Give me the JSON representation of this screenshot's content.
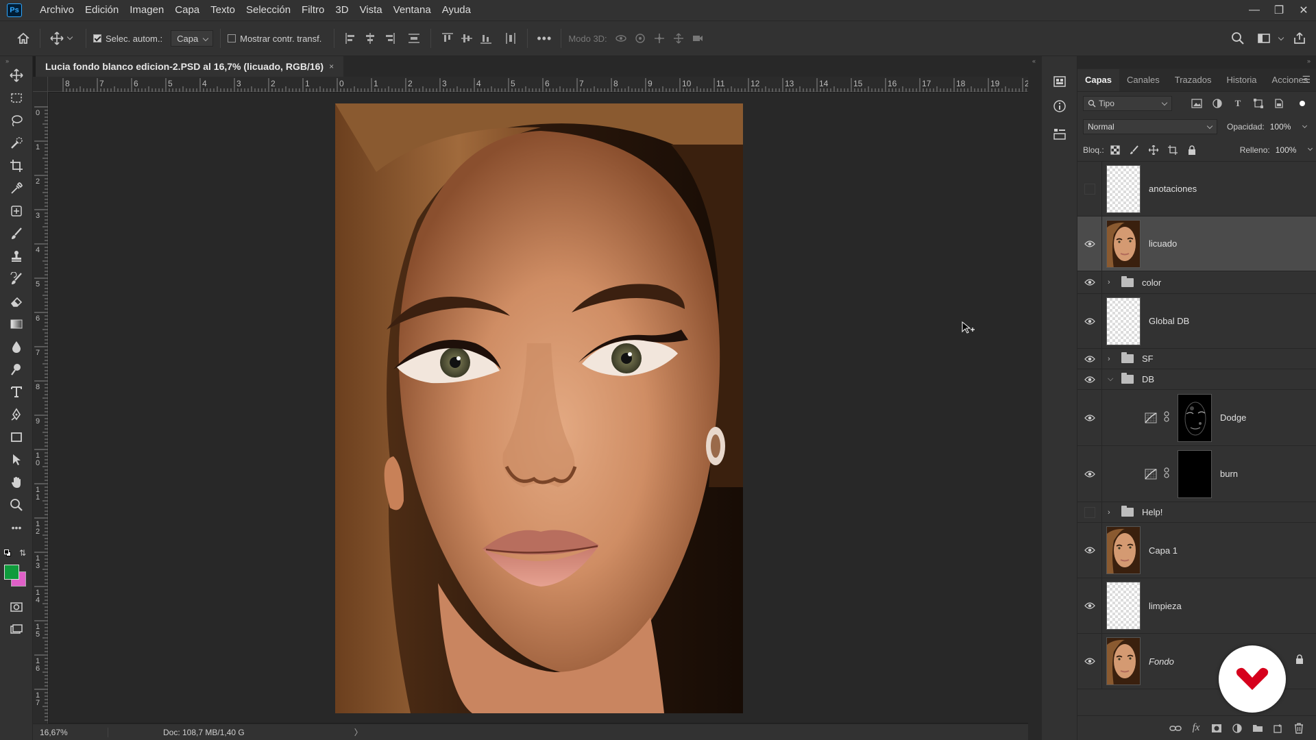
{
  "app": {
    "logo_text": "Ps"
  },
  "menu": [
    "Archivo",
    "Edición",
    "Imagen",
    "Capa",
    "Texto",
    "Selección",
    "Filtro",
    "3D",
    "Vista",
    "Ventana",
    "Ayuda"
  ],
  "options": {
    "auto_select_label": "Selec. autom.:",
    "auto_select_target": "Capa",
    "show_transform_label": "Mostrar contr. transf.",
    "mode_3d_label": "Modo 3D:"
  },
  "document": {
    "tab_title": "Lucia fondo blanco edicion-2.PSD al 16,7% (licuado, RGB/16)",
    "tab_close": "×"
  },
  "ruler": {
    "h_labels": [
      "8",
      "7",
      "6",
      "5",
      "4",
      "3",
      "2",
      "1",
      "0",
      "1",
      "2",
      "3",
      "4",
      "5",
      "6",
      "7",
      "8",
      "9",
      "10",
      "11",
      "12",
      "13",
      "14",
      "15",
      "16",
      "17",
      "18",
      "19",
      "2"
    ],
    "v_labels": [
      "0",
      "1",
      "2",
      "3",
      "4",
      "5",
      "6",
      "7",
      "8",
      "9",
      "10",
      "11",
      "12",
      "13",
      "14",
      "15",
      "16",
      "17"
    ]
  },
  "status": {
    "zoom": "16,67%",
    "doc": "Doc: 108,7 MB/1,40 G",
    "arrow": "〉"
  },
  "panel": {
    "tabs": [
      "Capas",
      "Canales",
      "Trazados",
      "Historia",
      "Acciones"
    ],
    "active_tab": "Capas",
    "filter_type": "Tipo",
    "blend_mode": "Normal",
    "opacity_label": "Opacidad:",
    "opacity_value": "100%",
    "lock_label": "Bloq.:",
    "fill_label": "Relleno:",
    "fill_value": "100%"
  },
  "layers": [
    {
      "name": "anotaciones",
      "kind": "layer",
      "visible": false,
      "thumb": "trans",
      "height": 80
    },
    {
      "name": "licuado",
      "kind": "layer",
      "visible": true,
      "thumb": "face",
      "height": 80,
      "selected": true
    },
    {
      "name": "color",
      "kind": "group",
      "visible": true,
      "expanded": false,
      "height": 33
    },
    {
      "name": "Global DB",
      "kind": "layer",
      "visible": true,
      "thumb": "trans",
      "height": 80
    },
    {
      "name": "SF",
      "kind": "group",
      "visible": true,
      "expanded": false,
      "height": 30
    },
    {
      "name": "DB",
      "kind": "group",
      "visible": true,
      "expanded": true,
      "height": 30
    },
    {
      "name": "Dodge",
      "kind": "adjustment",
      "visible": true,
      "thumb": "dodge",
      "height": 82
    },
    {
      "name": "burn",
      "kind": "adjustment",
      "visible": true,
      "thumb": "black",
      "height": 82
    },
    {
      "name": "Help!",
      "kind": "group",
      "visible": false,
      "expanded": false,
      "height": 30
    },
    {
      "name": "Capa 1",
      "kind": "layer",
      "visible": true,
      "thumb": "face",
      "height": 81
    },
    {
      "name": "limpieza",
      "kind": "layer",
      "visible": true,
      "thumb": "trans",
      "height": 81
    },
    {
      "name": "Fondo",
      "kind": "background",
      "visible": true,
      "thumb": "face",
      "height": 81
    }
  ],
  "colors": {
    "foreground": "#0f9b3c",
    "background": "#e060c8",
    "brand_red": "#d6001c"
  }
}
